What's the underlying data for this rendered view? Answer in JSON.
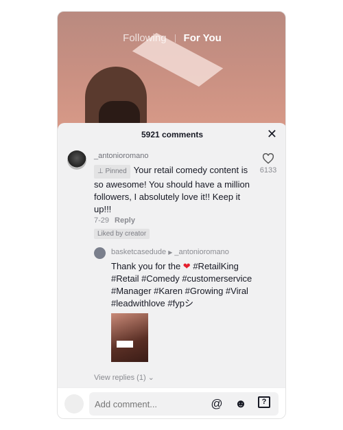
{
  "tabs": {
    "following": "Following",
    "for_you": "For You"
  },
  "comments": {
    "count_label": "5921 comments",
    "main": {
      "username": "_antonioromano",
      "pinned_label": "Pinned",
      "text": "Your retail comedy content is so awesome! You should have a million followers, I absolutely love it!! Keep it up!!!",
      "likes": "6133",
      "date": "7-29",
      "reply_label": "Reply",
      "liked_by": "Liked by creator"
    },
    "reply": {
      "username": "basketcasedude",
      "replying_to": "_antonioromano",
      "text_before": "Thank you for the",
      "text_after": "#RetailKing #Retail #Comedy #customerservice #Manager #Karen #Growing #Viral #leadwithlove #fypシ"
    },
    "view_replies": "View replies (1)"
  },
  "input": {
    "placeholder": "Add comment..."
  },
  "colors": {
    "heart": "#e4202e",
    "panel": "#f1f1f2"
  }
}
